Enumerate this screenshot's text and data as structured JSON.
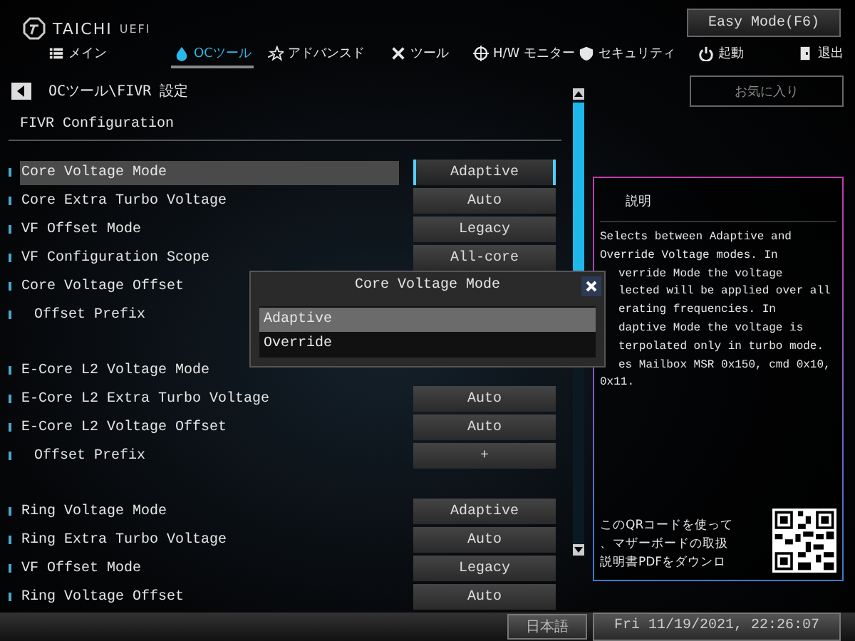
{
  "logo": {
    "brand": "TAICHI",
    "suffix": "UEFI"
  },
  "easy_mode_button": "Easy Mode(F6)",
  "tabs": [
    {
      "label": "メイン",
      "selected": false
    },
    {
      "label": "OCツール",
      "selected": true
    },
    {
      "label": "アドバンスド",
      "selected": false
    },
    {
      "label": "ツール",
      "selected": false
    },
    {
      "label": "H/W モニター",
      "selected": false
    },
    {
      "label": "セキュリティ",
      "selected": false
    },
    {
      "label": "起動",
      "selected": false
    },
    {
      "label": "退出",
      "selected": false
    }
  ],
  "breadcrumb": "OCツール\\FIVR 設定",
  "favorites_button": "お気に入り",
  "section_title": "FIVR Configuration",
  "groups": [
    [
      {
        "label": "Core Voltage Mode",
        "value": "Adaptive",
        "selected": true
      },
      {
        "label": "Core Extra Turbo Voltage",
        "value": "Auto",
        "selected": false
      },
      {
        "label": "VF Offset Mode",
        "value": "Legacy",
        "selected": false
      },
      {
        "label": "VF Configuration Scope",
        "value": "All-core",
        "selected": false
      },
      {
        "label": "Core Voltage Offset",
        "selected": false,
        "children": [
          {
            "label": "Offset Prefix",
            "selected": false
          }
        ]
      }
    ],
    [
      {
        "label": "E-Core L2 Voltage Mode",
        "selected": false
      },
      {
        "label": "E-Core L2 Extra Turbo Voltage",
        "value": "Auto",
        "selected": false
      },
      {
        "label": "E-Core L2 Voltage Offset",
        "value": "Auto",
        "selected": false,
        "children": [
          {
            "label": "Offset Prefix",
            "value": "+",
            "selected": false
          }
        ]
      }
    ],
    [
      {
        "label": "Ring Voltage Mode",
        "value": "Adaptive",
        "selected": false
      },
      {
        "label": "Ring Extra Turbo Voltage",
        "value": "Auto",
        "selected": false
      },
      {
        "label": "VF Offset Mode",
        "value": "Legacy",
        "selected": false
      },
      {
        "label": "Ring Voltage Offset",
        "value": "Auto",
        "selected": false
      }
    ]
  ],
  "popup": {
    "title": "Core Voltage Mode",
    "options": [
      {
        "label": "Adaptive",
        "selected": true
      },
      {
        "label": "Override",
        "selected": false
      }
    ]
  },
  "help_panel": {
    "title": "説明",
    "lines": [
      {
        "text": "Selects between Adaptive and",
        "clipped": false
      },
      {
        "text": "Override Voltage modes. In",
        "clipped": false
      },
      {
        "text": "verride Mode the voltage",
        "clipped": true
      },
      {
        "text": "lected will be applied over all",
        "clipped": true
      },
      {
        "text": "erating frequencies. In",
        "clipped": true
      },
      {
        "text": "daptive Mode the voltage is",
        "clipped": true
      },
      {
        "text": "terpolated only in turbo mode.",
        "clipped": true
      },
      {
        "text": "es Mailbox MSR 0x150, cmd 0x10,",
        "clipped": true
      },
      {
        "text": "0x11.",
        "clipped": false
      }
    ],
    "qr_text": [
      "このQRコードを使って",
      "、マザーボードの取扱",
      "説明書PDFをダウンロ"
    ]
  },
  "status_bar": {
    "language": "日本語",
    "datetime": "Fri 11/19/2021, 22:26:07"
  }
}
